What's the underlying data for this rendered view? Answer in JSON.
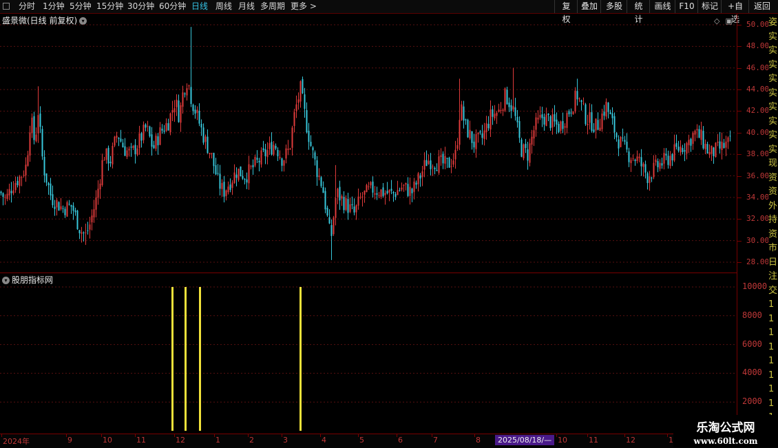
{
  "toolbar": {
    "periods": [
      {
        "label": "分时",
        "active": false
      },
      {
        "label": "1分钟",
        "active": false
      },
      {
        "label": "5分钟",
        "active": false
      },
      {
        "label": "15分钟",
        "active": false
      },
      {
        "label": "30分钟",
        "active": false
      },
      {
        "label": "60分钟",
        "active": false
      },
      {
        "label": "日线",
        "active": true
      },
      {
        "label": "周线",
        "active": false
      },
      {
        "label": "月线",
        "active": false
      },
      {
        "label": "多周期",
        "active": false
      },
      {
        "label": "更多 >",
        "active": false
      }
    ],
    "actions": [
      "复权",
      "叠加",
      "多股",
      "统计",
      "画线",
      "F10",
      "标记",
      "+自选",
      "返回"
    ]
  },
  "main_chart": {
    "title": "盛景微(日线 前复权)",
    "y_axis": [
      "50.00",
      "48.00",
      "46.00",
      "44.00",
      "42.00",
      "40.00",
      "38.00",
      "36.00",
      "34.00",
      "32.00",
      "30.00",
      "28.00"
    ],
    "colors": {
      "up": "#e03b3b",
      "down": "#38c8dc",
      "grid": "#5a1010",
      "axis_text": "#c03838"
    }
  },
  "indicator": {
    "title": "股朋指标网",
    "y_axis": [
      "10000",
      "8000",
      "6000",
      "4000",
      "2000"
    ],
    "signal_color": "#f2e23a"
  },
  "date_axis": {
    "labels": [
      "2024年",
      "9",
      "10",
      "11",
      "12",
      "1",
      "2",
      "3",
      "4",
      "5",
      "6",
      "7",
      "8",
      "10",
      "11",
      "12",
      "1"
    ],
    "highlight": "2025/08/18/—"
  },
  "side_strip": [
    "姿",
    "实",
    "实",
    "实",
    "实",
    "实",
    "实",
    "实",
    "实",
    "实",
    "现",
    "资",
    "资",
    "外",
    "持",
    "资",
    "市",
    "日",
    "注",
    "交",
    "1",
    "1",
    "1",
    "1",
    "1",
    "1",
    "1",
    "1",
    "1"
  ],
  "watermark": {
    "title": "乐淘公式网",
    "url": "www.60lt.com"
  },
  "chart_data": {
    "type": "candlestick",
    "title": "盛景微(日线 前复权)",
    "ylim": [
      27,
      50.5
    ],
    "y_ticks": [
      28,
      30,
      32,
      34,
      36,
      38,
      40,
      42,
      44,
      46,
      48,
      50
    ],
    "keypoints": [
      {
        "t": 0,
        "p": 34.5
      },
      {
        "t": 8,
        "p": 33.8
      },
      {
        "t": 18,
        "p": 35.2
      },
      {
        "t": 30,
        "p": 36.0
      },
      {
        "t": 38,
        "p": 37.0
      },
      {
        "t": 44,
        "p": 41.5
      },
      {
        "t": 50,
        "p": 39.0
      },
      {
        "t": 55,
        "p": 42.0
      },
      {
        "t": 62,
        "p": 37.0
      },
      {
        "t": 74,
        "p": 34.0
      },
      {
        "t": 90,
        "p": 33.0
      },
      {
        "t": 104,
        "p": 33.2
      },
      {
        "t": 116,
        "p": 31.0
      },
      {
        "t": 124,
        "p": 30.5
      },
      {
        "t": 130,
        "p": 31.5
      },
      {
        "t": 140,
        "p": 34.0
      },
      {
        "t": 150,
        "p": 38.0
      },
      {
        "t": 160,
        "p": 37.5
      },
      {
        "t": 170,
        "p": 40.0
      },
      {
        "t": 180,
        "p": 38.5
      },
      {
        "t": 190,
        "p": 38.0
      },
      {
        "t": 200,
        "p": 39.0
      },
      {
        "t": 212,
        "p": 40.5
      },
      {
        "t": 222,
        "p": 38.5
      },
      {
        "t": 232,
        "p": 40.0
      },
      {
        "t": 244,
        "p": 41.0
      },
      {
        "t": 254,
        "p": 43.0
      },
      {
        "t": 260,
        "p": 41.5
      },
      {
        "t": 266,
        "p": 44.0
      },
      {
        "t": 272,
        "p": 45.0
      },
      {
        "t": 278,
        "p": 43.0
      },
      {
        "t": 286,
        "p": 41.5
      },
      {
        "t": 296,
        "p": 39.5
      },
      {
        "t": 306,
        "p": 38.0
      },
      {
        "t": 316,
        "p": 35.5
      },
      {
        "t": 324,
        "p": 34.5
      },
      {
        "t": 334,
        "p": 35.5
      },
      {
        "t": 344,
        "p": 36.5
      },
      {
        "t": 356,
        "p": 36.0
      },
      {
        "t": 370,
        "p": 37.0
      },
      {
        "t": 384,
        "p": 38.0
      },
      {
        "t": 398,
        "p": 39.0
      },
      {
        "t": 410,
        "p": 37.5
      },
      {
        "t": 420,
        "p": 38.5
      },
      {
        "t": 428,
        "p": 42.0
      },
      {
        "t": 436,
        "p": 44.0
      },
      {
        "t": 444,
        "p": 41.0
      },
      {
        "t": 452,
        "p": 38.5
      },
      {
        "t": 460,
        "p": 36.5
      },
      {
        "t": 468,
        "p": 35.0
      },
      {
        "t": 474,
        "p": 32.5
      },
      {
        "t": 480,
        "p": 30.0
      },
      {
        "t": 488,
        "p": 34.5
      },
      {
        "t": 500,
        "p": 33.5
      },
      {
        "t": 514,
        "p": 32.5
      },
      {
        "t": 524,
        "p": 34.0
      },
      {
        "t": 540,
        "p": 34.8
      },
      {
        "t": 556,
        "p": 34.5
      },
      {
        "t": 570,
        "p": 34.3
      },
      {
        "t": 584,
        "p": 35.0
      },
      {
        "t": 598,
        "p": 34.5
      },
      {
        "t": 610,
        "p": 36.0
      },
      {
        "t": 620,
        "p": 37.5
      },
      {
        "t": 636,
        "p": 37.2
      },
      {
        "t": 650,
        "p": 37.0
      },
      {
        "t": 662,
        "p": 38.0
      },
      {
        "t": 668,
        "p": 42.5
      },
      {
        "t": 676,
        "p": 40.5
      },
      {
        "t": 688,
        "p": 39.0
      },
      {
        "t": 700,
        "p": 39.5
      },
      {
        "t": 712,
        "p": 41.5
      },
      {
        "t": 724,
        "p": 42.0
      },
      {
        "t": 734,
        "p": 43.5
      },
      {
        "t": 746,
        "p": 42.0
      },
      {
        "t": 756,
        "p": 38.5
      },
      {
        "t": 766,
        "p": 38.0
      },
      {
        "t": 776,
        "p": 40.5
      },
      {
        "t": 788,
        "p": 41.5
      },
      {
        "t": 800,
        "p": 41.0
      },
      {
        "t": 812,
        "p": 40.5
      },
      {
        "t": 826,
        "p": 42.0
      },
      {
        "t": 838,
        "p": 43.5
      },
      {
        "t": 850,
        "p": 41.5
      },
      {
        "t": 866,
        "p": 40.5
      },
      {
        "t": 880,
        "p": 42.5
      },
      {
        "t": 896,
        "p": 39.5
      },
      {
        "t": 912,
        "p": 38.0
      },
      {
        "t": 926,
        "p": 37.5
      },
      {
        "t": 940,
        "p": 36.0
      },
      {
        "t": 956,
        "p": 37.0
      },
      {
        "t": 968,
        "p": 37.5
      },
      {
        "t": 984,
        "p": 38.5
      },
      {
        "t": 998,
        "p": 39.0
      },
      {
        "t": 1008,
        "p": 40.0
      },
      {
        "t": 1018,
        "p": 39.5
      },
      {
        "t": 1030,
        "p": 38.0
      },
      {
        "t": 1044,
        "p": 38.5
      },
      {
        "t": 1058,
        "p": 39.0
      }
    ],
    "spikes": [
      {
        "t": 55,
        "high": 44.3
      },
      {
        "t": 277,
        "high": 49.8
      },
      {
        "t": 438,
        "high": 45.0
      },
      {
        "t": 480,
        "low": 28.2
      },
      {
        "t": 487,
        "high": 37.0
      },
      {
        "t": 746,
        "high": 46.0
      },
      {
        "t": 838,
        "high": 45.0
      },
      {
        "t": 666,
        "high": 45.0
      },
      {
        "t": 124,
        "low": 29.6
      },
      {
        "t": 940,
        "low": 35.4
      }
    ],
    "indicator": {
      "type": "bar",
      "ylim": [
        0,
        11000
      ],
      "y_ticks": [
        2000,
        4000,
        6000,
        8000,
        10000
      ],
      "signals": [
        {
          "t": 250,
          "value": 10000
        },
        {
          "t": 269,
          "value": 10000
        },
        {
          "t": 290,
          "value": 10000
        },
        {
          "t": 436,
          "value": 10000
        }
      ]
    }
  }
}
